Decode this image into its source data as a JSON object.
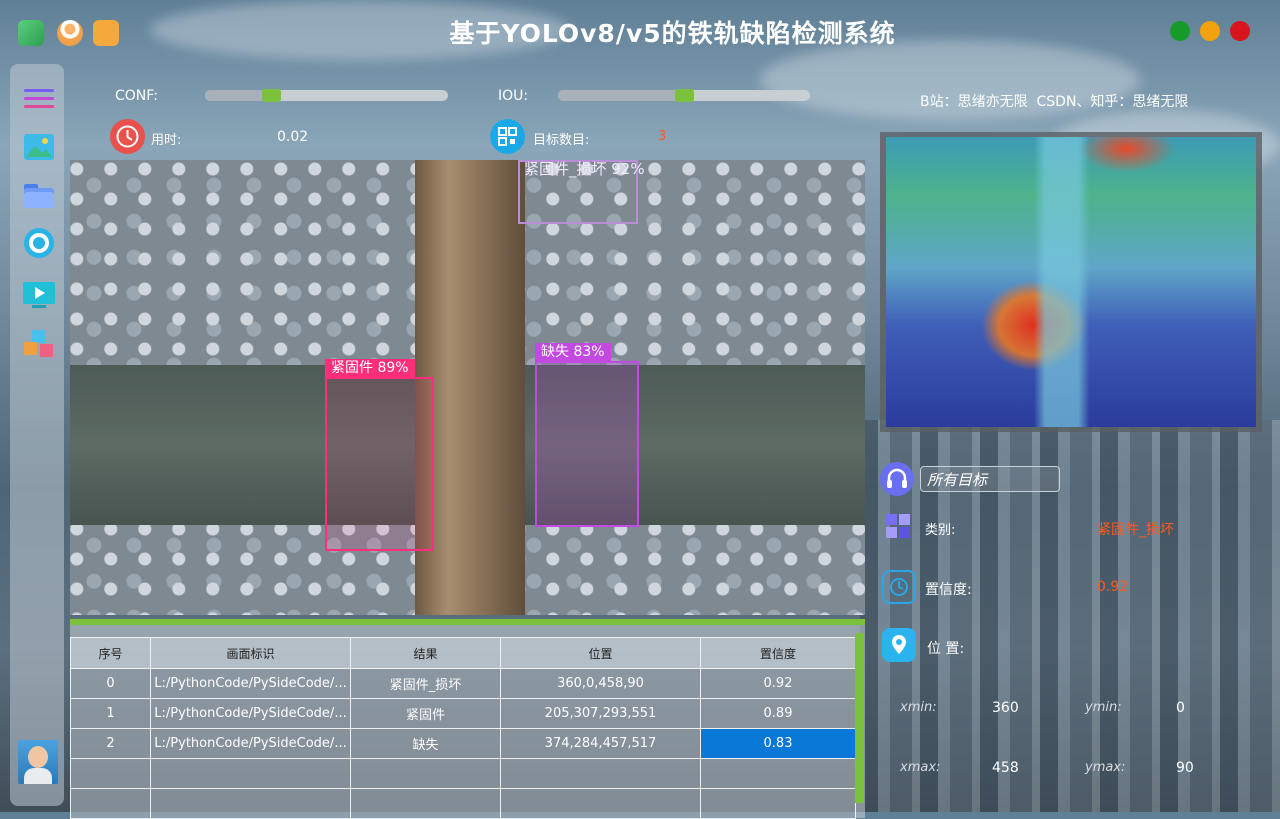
{
  "app": {
    "title": "基于YOLOv8/v5的铁轨缺陷检测系统",
    "credit": "B站：思绪亦无限  CSDN、知乎：思绪无限",
    "window_controls": [
      "close-green",
      "minimize-yellow",
      "maximize-red"
    ]
  },
  "controls": {
    "conf_label": "CONF:",
    "conf_value": 0.3,
    "iou_label": "IOU:",
    "iou_value": 0.5,
    "time_label": "用时:",
    "time_value": "0.02",
    "count_label": "目标数目:",
    "count_value": "3"
  },
  "sidebar": {
    "items": [
      "menu-icon",
      "image-icon",
      "folder-icon",
      "camera-icon",
      "video-icon",
      "model-icon"
    ]
  },
  "detections": [
    {
      "label": "紧固件_损坏  92%",
      "color": "#b98ed6"
    },
    {
      "label": "紧固件  89%",
      "color": "#ff2d7a"
    },
    {
      "label": "缺失  83%",
      "color": "#c24ae0"
    }
  ],
  "info": {
    "target_select": "所有目标",
    "class_label": "类别:",
    "class_value": "紧固件_损坏",
    "conf_label": "置信度:",
    "conf_value": "0.92",
    "pos_label": "位 置:",
    "xmin_label": "xmin:",
    "xmin_value": "360",
    "ymin_label": "ymin:",
    "ymin_value": "0",
    "xmax_label": "xmax:",
    "xmax_value": "458",
    "ymax_label": "ymax:",
    "ymax_value": "90"
  },
  "table": {
    "headers": [
      "序号",
      "画面标识",
      "结果",
      "位置",
      "置信度"
    ],
    "rows": [
      [
        "0",
        "L:/PythonCode/PySideCode/...",
        "紧固件_损坏",
        "360,0,458,90",
        "0.92"
      ],
      [
        "1",
        "L:/PythonCode/PySideCode/...",
        "紧固件",
        "205,307,293,551",
        "0.89"
      ],
      [
        "2",
        "L:/PythonCode/PySideCode/...",
        "缺失",
        "374,284,457,517",
        "0.83"
      ]
    ]
  },
  "colors": {
    "accent_green": "#7cc13c",
    "highlight_red": "#ff5a1f",
    "selection_blue": "#0a78d6"
  }
}
